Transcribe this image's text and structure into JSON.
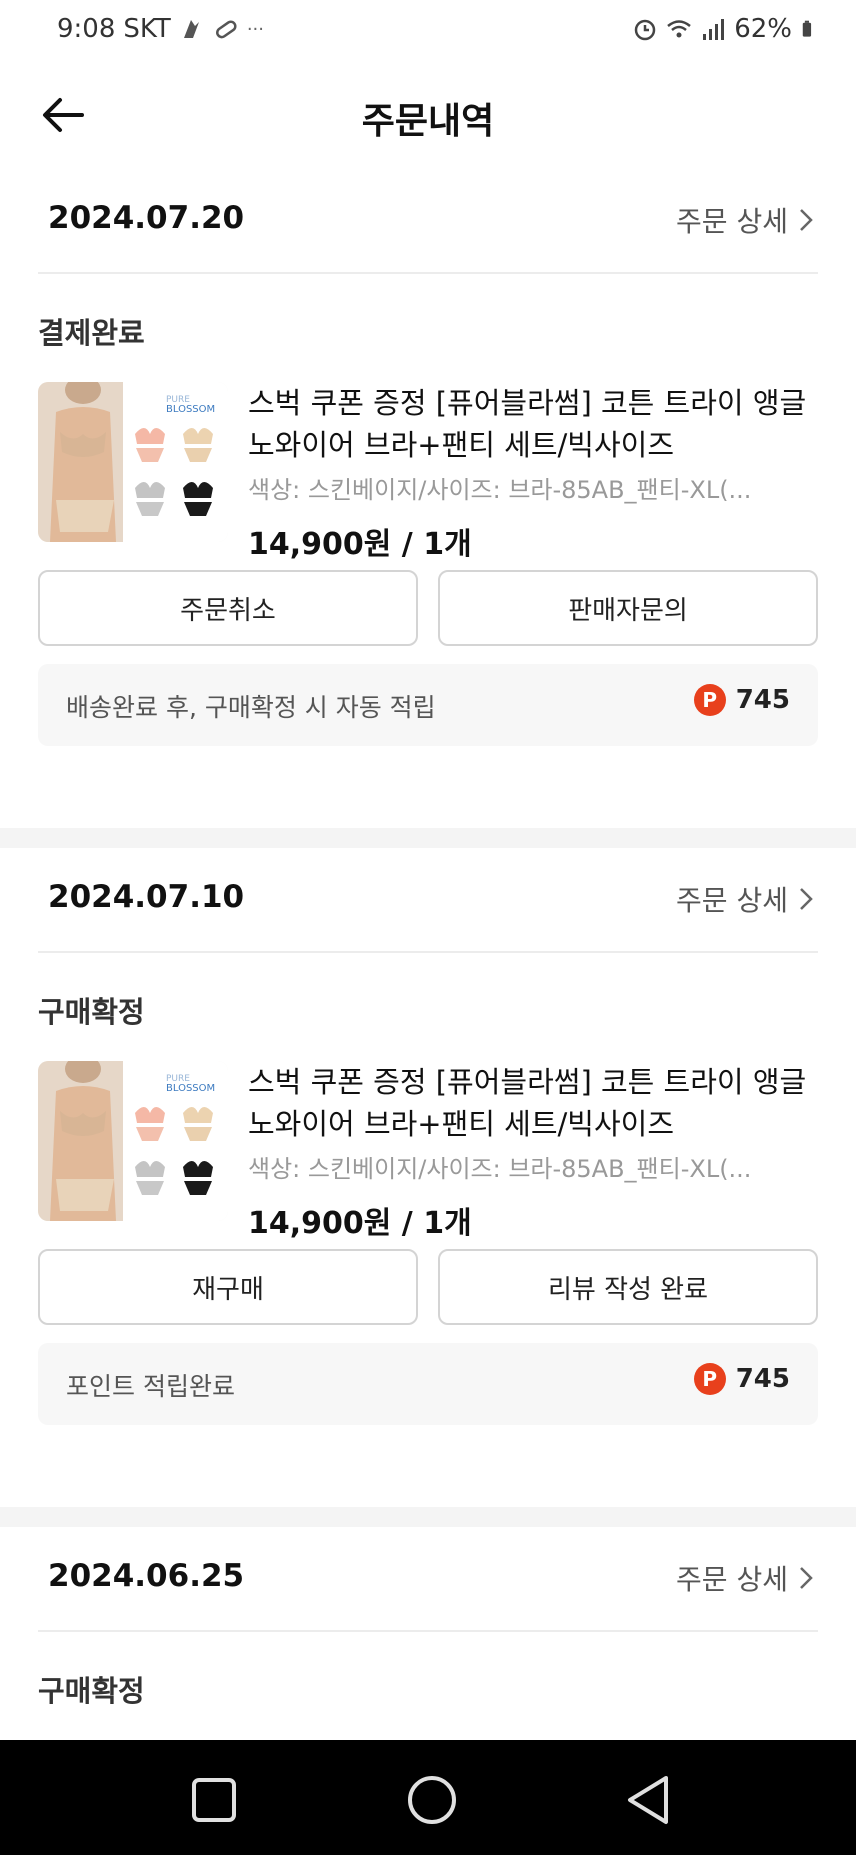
{
  "status_bar": {
    "time": "9:08",
    "carrier": "SKT",
    "dots": "···",
    "battery": "62%"
  },
  "header": {
    "title": "주문내역"
  },
  "orders": [
    {
      "date": "2024.07.20",
      "detail_label": "주문 상세",
      "status": "결제완료",
      "product": {
        "name": "스벅 쿠폰 증정 [퓨어블라썸] 코튼 트라이 앵글 노와이어 브라+팬티 세트/빅사이즈",
        "option": "색상: 스킨베이지/사이즈: 브라-85AB_팬티-XL(...",
        "price": "14,900원 / 1개",
        "thumb_brand_1": "PURE",
        "thumb_brand_2": "BLOSSOM"
      },
      "buttons": [
        "주문취소",
        "판매자문의"
      ],
      "point_text": "배송완료 후, 구매확정 시 자동 적립",
      "point_badge": "P",
      "point_value": "745"
    },
    {
      "date": "2024.07.10",
      "detail_label": "주문 상세",
      "status": "구매확정",
      "product": {
        "name": "스벅 쿠폰 증정 [퓨어블라썸] 코튼 트라이 앵글 노와이어 브라+팬티 세트/빅사이즈",
        "option": "색상: 스킨베이지/사이즈: 브라-85AB_팬티-XL(...",
        "price": "14,900원 / 1개",
        "thumb_brand_1": "PURE",
        "thumb_brand_2": "BLOSSOM"
      },
      "buttons": [
        "재구매",
        "리뷰 작성 완료"
      ],
      "point_text": "포인트 적립완료",
      "point_badge": "P",
      "point_value": "745"
    },
    {
      "date": "2024.06.25",
      "detail_label": "주문 상세",
      "status": "구매확정"
    }
  ],
  "colors": {
    "point_badge": "#e8401c",
    "nav_bg": "#000000",
    "divider": "#f4f4f4"
  }
}
